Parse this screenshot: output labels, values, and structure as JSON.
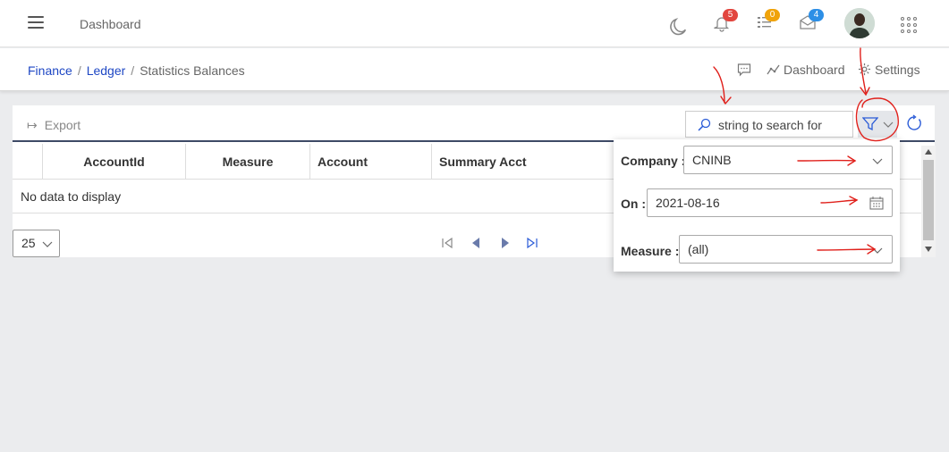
{
  "header": {
    "title": "Dashboard",
    "notifications_count": "5",
    "tasks_count": "0",
    "messages_count": "4",
    "colors": {
      "bell_badge": "#e2463f",
      "tasks_badge": "#f0a30a",
      "messages_badge": "#2d8fe6"
    }
  },
  "breadcrumb": {
    "items": [
      "Finance",
      "Ledger"
    ],
    "current": "Statistics Balances"
  },
  "subbar": {
    "dashboard_label": "Dashboard",
    "settings_label": "Settings"
  },
  "toolbar": {
    "export_label": "Export",
    "search_placeholder": "string to search for"
  },
  "table": {
    "columns": [
      "AccountId",
      "Measure",
      "Account",
      "Summary Acct"
    ],
    "empty_text": "No data to display",
    "page_size": "25"
  },
  "filter_popup": {
    "company_label": "Company :",
    "company_value": "CNINB",
    "on_label": "On :",
    "on_value": "2021-08-16",
    "measure_label": "Measure :",
    "measure_value": "(all)"
  },
  "icons": [
    "hamburger-icon",
    "moon-icon",
    "bell-icon",
    "tasks-icon",
    "mail-icon",
    "apps-grid-icon",
    "comment-icon",
    "dashboard-chart-icon",
    "settings-gear-icon",
    "export-icon",
    "search-icon",
    "filter-icon",
    "chevron-down-icon",
    "refresh-icon",
    "calendar-icon",
    "first-page-icon",
    "prev-page-icon",
    "next-page-icon",
    "last-page-icon"
  ],
  "accent_color": "#1e47c4"
}
